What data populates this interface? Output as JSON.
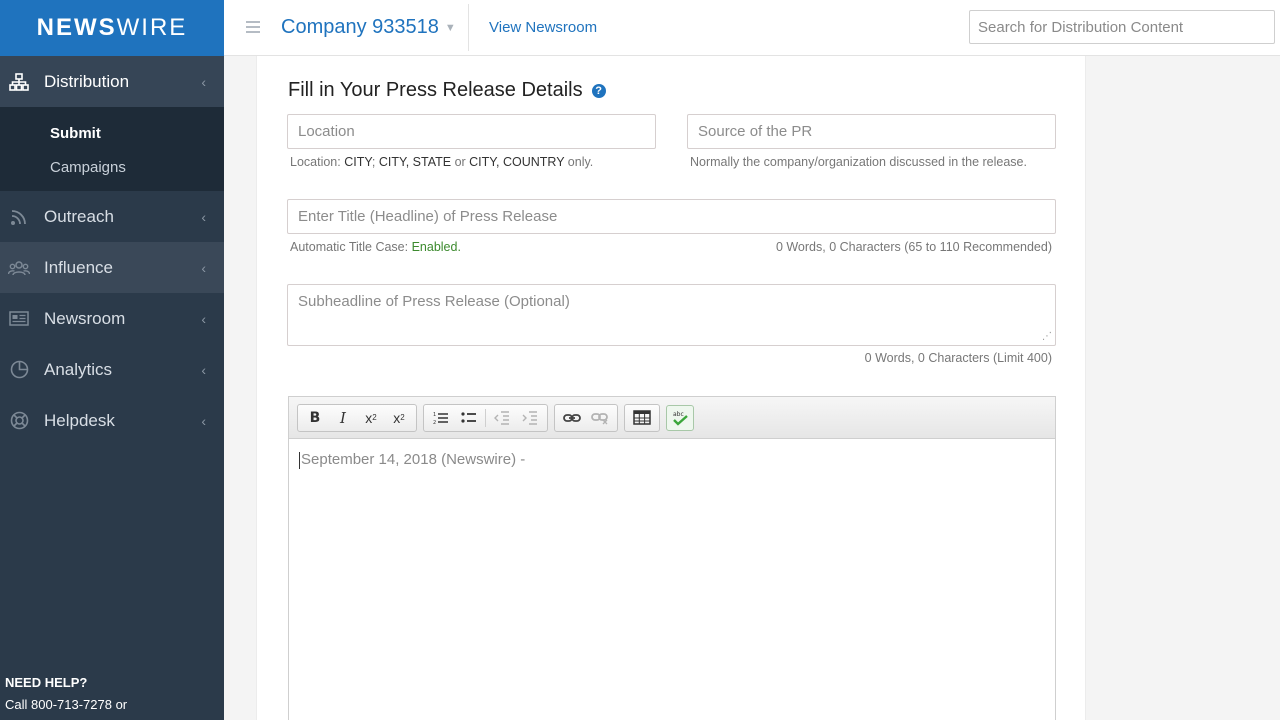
{
  "brand": {
    "name_bold": "NEWS",
    "name_light": "WIRE"
  },
  "sidebar": {
    "items": [
      {
        "label": "Distribution",
        "icon": "sitemap-icon"
      },
      {
        "label": "Outreach",
        "icon": "rss-icon"
      },
      {
        "label": "Influence",
        "icon": "group-icon"
      },
      {
        "label": "Newsroom",
        "icon": "newspaper-icon"
      },
      {
        "label": "Analytics",
        "icon": "pie-chart-icon"
      },
      {
        "label": "Helpdesk",
        "icon": "lifebuoy-icon"
      }
    ],
    "sub_items": [
      {
        "label": "Submit",
        "active": true
      },
      {
        "label": "Campaigns",
        "active": false
      }
    ],
    "chevron": "‹",
    "help_title": "NEED HELP?",
    "help_text": "Call 800-713-7278 or"
  },
  "topbar": {
    "company": "Company 933518",
    "view_newsroom": "View Newsroom",
    "search_placeholder": "Search for Distribution Content"
  },
  "form": {
    "title": "Fill in Your Press Release Details",
    "help_icon": "?",
    "location_placeholder": "Location",
    "location_hint_prefix": "Location: ",
    "location_hint_f1": "CITY",
    "location_hint_sep1": "; ",
    "location_hint_f2": "CITY, STATE",
    "location_hint_or": " or ",
    "location_hint_f3": "CITY, COUNTRY",
    "location_hint_suffix": " only.",
    "source_placeholder": "Source of the PR",
    "source_hint": "Normally the company/organization discussed in the release.",
    "title_placeholder": "Enter Title (Headline) of Press Release",
    "title_case_label": "Automatic Title Case: ",
    "title_case_value": "Enabled.",
    "title_count": "0 Words, 0 Characters (65 to 110 Recommended)",
    "subheadline_placeholder": "Subheadline of Press Release (Optional)",
    "subheadline_count": "0 Words, 0 Characters (Limit 400)",
    "editor_text": "September 14, 2018 (Newswire) -"
  },
  "toolbar": {
    "bold": "B",
    "italic": "I",
    "subscript": "x",
    "superscript": "x",
    "sub_mark": "2",
    "sup_mark": "2",
    "spell_mark": "abc"
  },
  "colors": {
    "brand_blue": "#1f73be",
    "sidebar_bg": "#2b3a4a",
    "enabled_green": "#3c8a2e"
  }
}
